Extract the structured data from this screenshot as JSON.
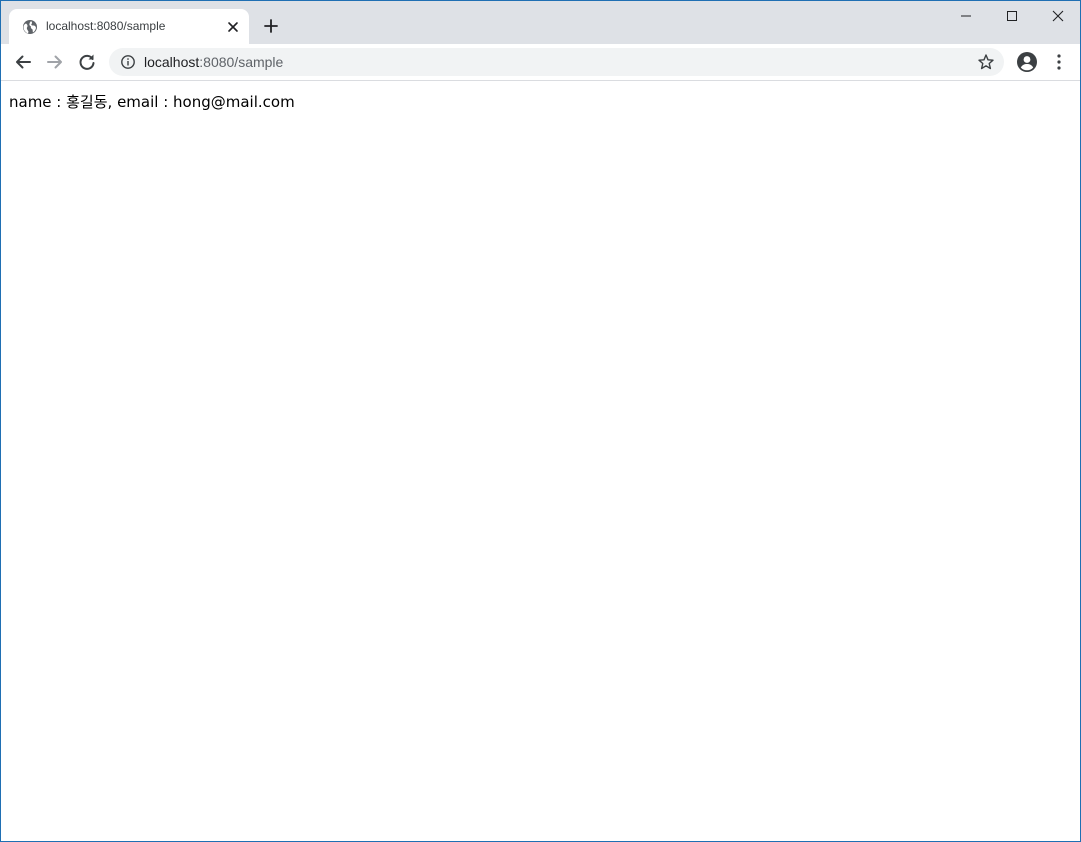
{
  "tab": {
    "title": "localhost:8080/sample",
    "favicon": "globe-icon"
  },
  "toolbar": {
    "url_host": "localhost",
    "url_rest": ":8080/sample"
  },
  "page": {
    "text": "name : 홍길동, email : hong@mail.com"
  },
  "colors": {
    "tabstrip_bg": "#dee1e6",
    "omnibox_bg": "#f1f3f4",
    "window_border": "#1f6fb3"
  }
}
